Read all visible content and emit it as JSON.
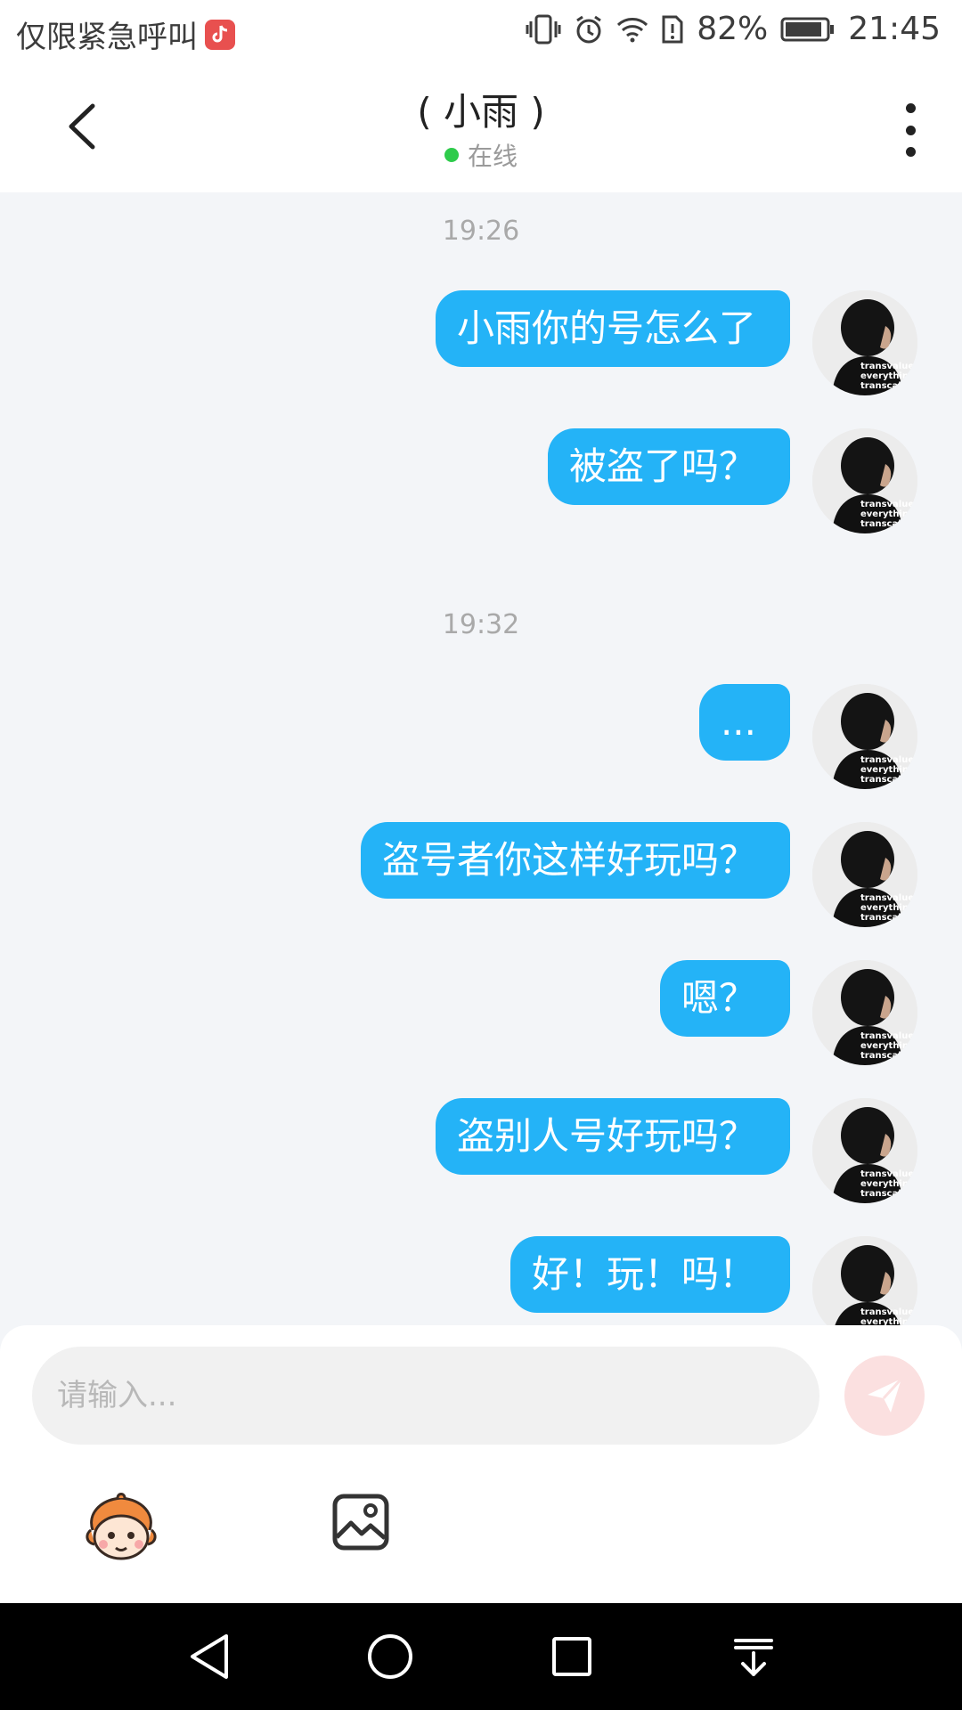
{
  "status_bar": {
    "carrier": "仅限紧急呼叫",
    "battery": "82%",
    "time": "21:45",
    "icons": [
      "tiktok-icon",
      "vibrate-icon",
      "alarm-icon",
      "wifi-icon",
      "sim-alert-icon",
      "battery-icon"
    ]
  },
  "header": {
    "title": "( 小雨 )",
    "presence": "在线",
    "presence_color": "#2ecb4b",
    "icons": [
      "back-arrow-icon",
      "more-vertical-icon"
    ]
  },
  "chat": {
    "bubble_color": "#24b3f7",
    "timestamps": [
      "19:26",
      "19:32"
    ],
    "messages": [
      "小雨你的号怎么了",
      "被盗了吗？",
      "...",
      "盗号者你这样好玩吗？",
      "嗯？",
      "盗别人号好玩吗？",
      "好！玩！吗！"
    ],
    "avatar_text": "transvalue\neverything\ntranscale"
  },
  "composer": {
    "placeholder": "请输入...",
    "icons": [
      "send-icon",
      "emoji-sticker-icon",
      "image-icon"
    ]
  },
  "nav": {
    "icons": [
      "nav-back-icon",
      "nav-home-icon",
      "nav-recents-icon",
      "nav-notification-icon"
    ]
  }
}
